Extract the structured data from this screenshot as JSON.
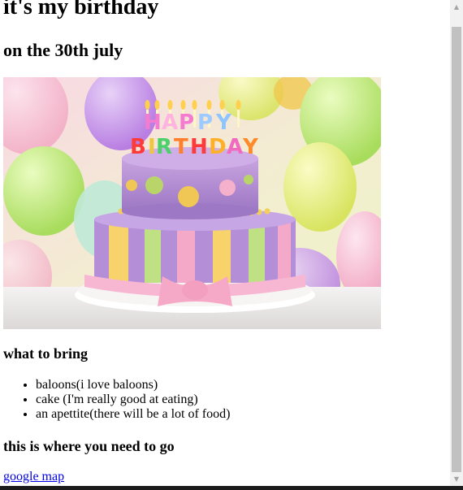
{
  "page": {
    "title": "it's my birthday",
    "subtitle": "on the 30th july"
  },
  "hero": {
    "cake_text": "HAPPY BIRTHDAY"
  },
  "bring": {
    "heading": "what to bring",
    "items": [
      "baloons(i love baloons)",
      "cake (I'm really good at eating)",
      "an apettite(there will be a lot of food)"
    ]
  },
  "location": {
    "heading": "this is where you need to go",
    "link_label": "google map"
  },
  "scrollbar": {
    "up_icon": "▲",
    "down_icon": "▼"
  },
  "colors": {
    "link": "#0000ee",
    "scroll_track": "#f1f1f1",
    "scroll_thumb": "#c1c1c1"
  }
}
